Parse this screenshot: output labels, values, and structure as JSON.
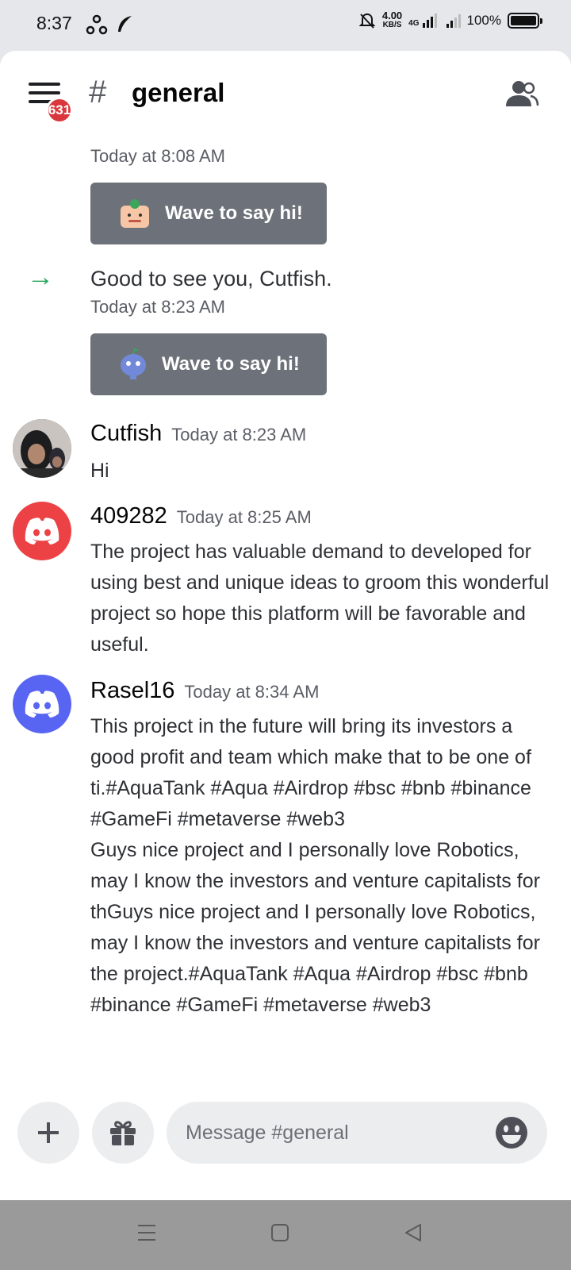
{
  "status_bar": {
    "time": "8:37",
    "net_speed_value": "4.00",
    "net_speed_unit": "KB/S",
    "network": "4G",
    "battery": "100%"
  },
  "header": {
    "unread_badge": "631",
    "hash": "#",
    "channel_name": "general"
  },
  "messages": {
    "top_timestamp": "Today at 8:08 AM",
    "wave_label_1": "Wave to say hi!",
    "welcome_text": "Good to see you, Cutfish.",
    "welcome_timestamp": "Today at 8:23 AM",
    "wave_label_2": "Wave to say hi!",
    "items": [
      {
        "author": "Cutfish",
        "timestamp": "Today at 8:23 AM",
        "text": "Hi"
      },
      {
        "author": "409282",
        "timestamp": "Today at 8:25 AM",
        "text": "The project has valuable demand to developed for using best and unique ideas to groom this wonderful project so hope this platform will be favorable and useful.",
        "avatar_color": "#ed4245"
      },
      {
        "author": "Rasel16",
        "timestamp": "Today at 8:34 AM",
        "text": "This project in the future will bring its investors a good profit and  team which make that to be one of ti.#AquaTank #Aqua #Airdrop #bsc #bnb #binance #GameFi #metaverse #web3\nGuys nice project and I personally love Robotics, may I know the investors and venture capitalists for thGuys nice project and I personally love Robotics, may I know the investors and venture capitalists for the project.#AquaTank #Aqua #Airdrop #bsc #bnb #binance #GameFi #metaverse #web3",
        "avatar_color": "#5865f2"
      }
    ]
  },
  "composer": {
    "placeholder": "Message #general"
  },
  "icons": {
    "menu": "hamburger-icon",
    "members": "members-icon",
    "add": "plus-icon",
    "gift": "gift-icon",
    "emoji": "emoji-icon",
    "join_arrow": "arrow-right-icon"
  },
  "colors": {
    "accent_blurple": "#5865f2",
    "red": "#ed4245",
    "green_arrow": "#23a55a",
    "badge": "#da373c"
  }
}
